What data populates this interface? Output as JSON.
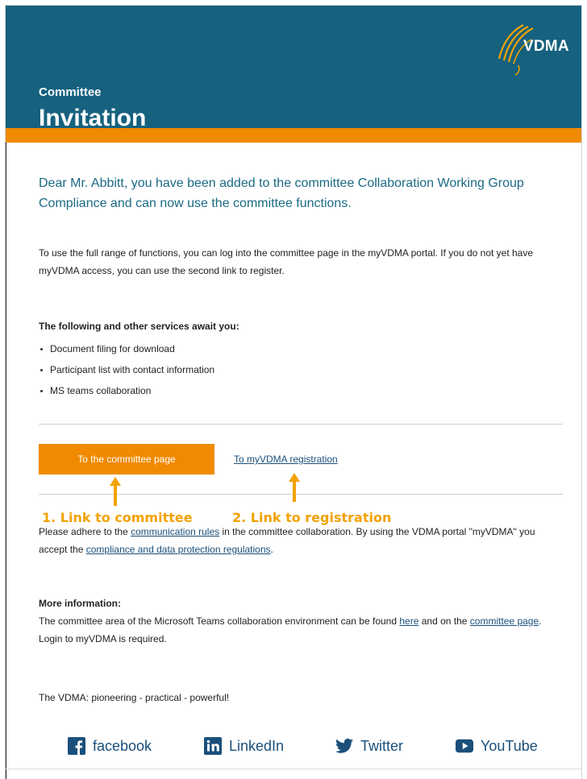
{
  "header": {
    "kicker": "Committee",
    "title": "Invitation",
    "logo_text": "VDMA",
    "colors": {
      "header_bg": "#15617e",
      "accent": "#f08a00"
    }
  },
  "intro": "Dear Mr. Abbitt, you have been added to the committee Collaboration Working Group Compliance and can now use the committee functions.",
  "access_text": "To use the full range of functions, you can log into the committee page in the myVDMA portal. If you do not yet have myVDMA access, you can use the second link to register.",
  "services": {
    "heading": "The following and other services await you:",
    "items": [
      "Document filing for download",
      "Participant list with contact information",
      "MS teams collaboration"
    ]
  },
  "actions": {
    "primary_label": "To the committee page",
    "registration_label": "To myVDMA registration"
  },
  "annotations": {
    "label_1": "1. Link to committee",
    "label_2": "2. Link to registration",
    "arrow_icon": "arrow-up-icon"
  },
  "rules": {
    "prefix": "Please adhere to the ",
    "link1": "communication rules",
    "middle": " in the committee collaboration. By using the VDMA portal \"myVDMA\" you accept the ",
    "link2": "compliance and data protection regulations",
    "suffix": "."
  },
  "more_info": {
    "heading": "More information:",
    "prefix": "The committee area of the Microsoft Teams collaboration environment can be found ",
    "link1": "here",
    "middle": " and on the ",
    "link2": "committee page",
    "suffix": ". Login to myVDMA is required."
  },
  "tagline": "The VDMA: pioneering - practical - powerful!",
  "social": [
    {
      "label": "facebook",
      "icon": "facebook-icon"
    },
    {
      "label": "LinkedIn",
      "icon": "linkedin-icon"
    },
    {
      "label": "Twitter",
      "icon": "twitter-icon"
    },
    {
      "label": "YouTube",
      "icon": "youtube-icon"
    }
  ]
}
